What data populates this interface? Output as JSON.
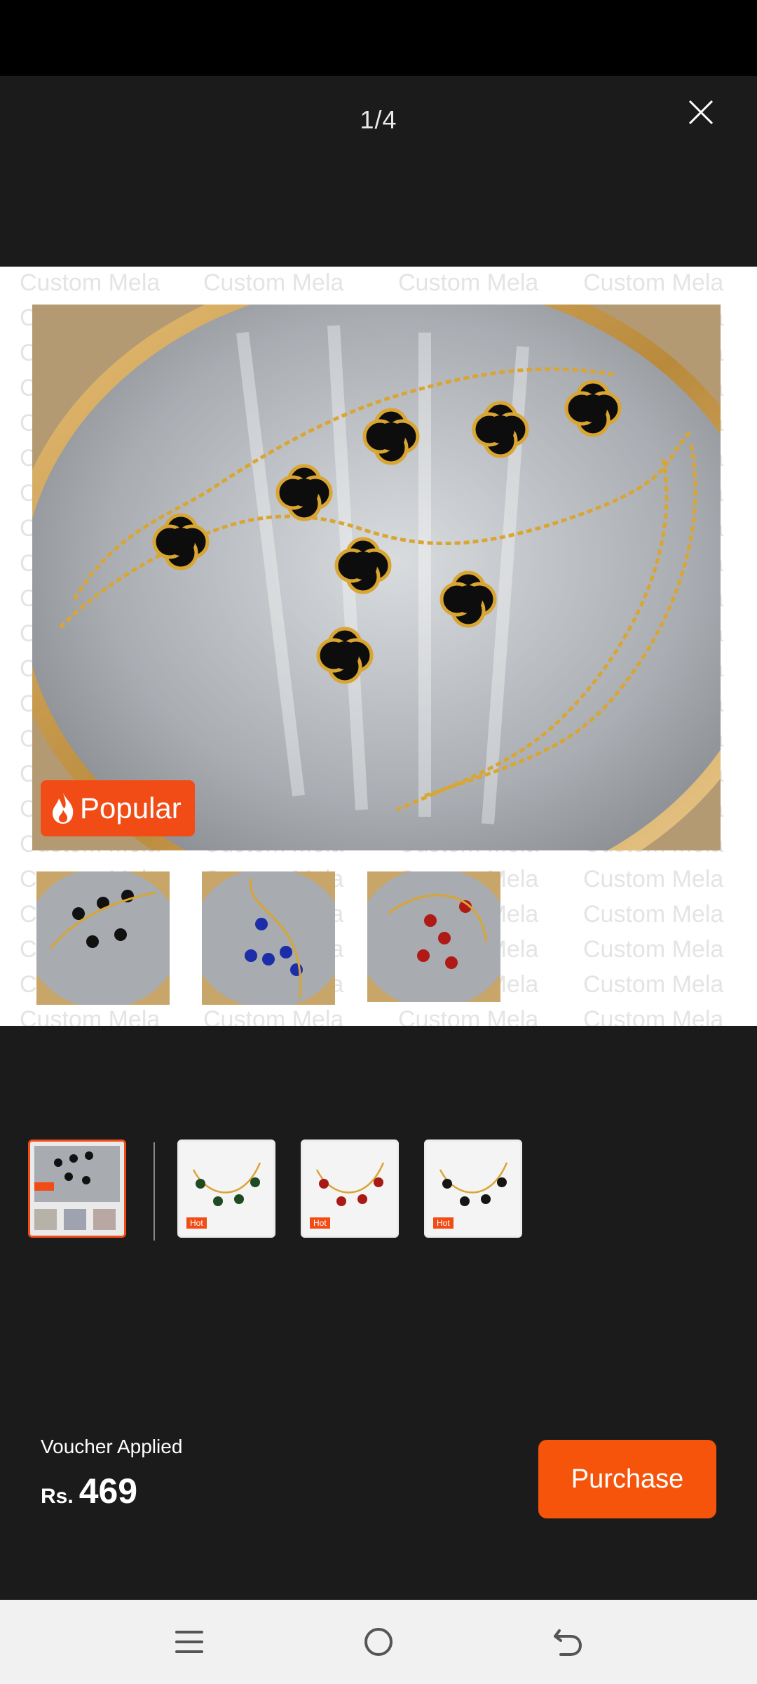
{
  "header": {
    "page_counter": "1/4",
    "close_icon": "close-icon"
  },
  "viewer": {
    "watermark": "Custom Mela",
    "badge_label": "Popular",
    "badge_icon": "flame-icon"
  },
  "filmstrip": {
    "items": [
      {
        "label": "",
        "active": true
      },
      {
        "label": "Hot",
        "active": false
      },
      {
        "label": "Hot",
        "active": false
      },
      {
        "label": "Hot",
        "active": false
      }
    ]
  },
  "footer": {
    "voucher_label": "Voucher Applied",
    "currency": "Rs.",
    "price": "469",
    "purchase_label": "Purchase"
  },
  "nav": {
    "icons": [
      "menu-icon",
      "home-icon",
      "back-icon"
    ]
  },
  "colors": {
    "accent": "#f5540a",
    "background": "#1b1b1c"
  }
}
